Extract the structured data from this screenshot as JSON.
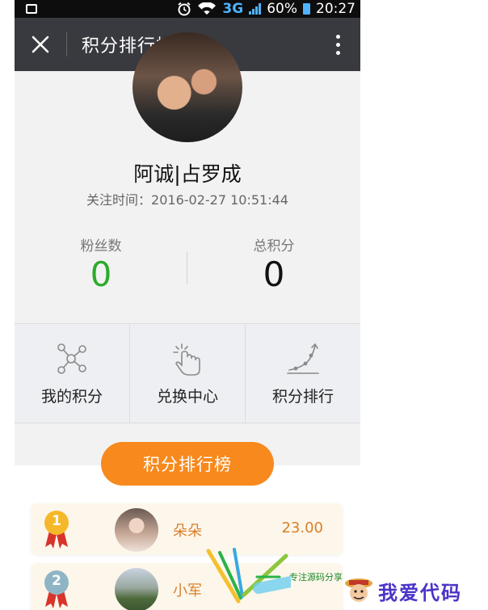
{
  "status_bar": {
    "network": "3G",
    "battery": "60%",
    "time": "20:27"
  },
  "header": {
    "title": "积分排行榜"
  },
  "profile": {
    "name": "阿诚|占罗成",
    "follow_time": "关注时间：2016-02-27 10:51:44",
    "fans_label": "粉丝数",
    "fans_value": "0",
    "points_label": "总积分",
    "points_value": "0"
  },
  "menu": {
    "items": [
      {
        "label": "我的积分",
        "icon": "network-nodes-icon"
      },
      {
        "label": "兑换中心",
        "icon": "tap-hand-icon"
      },
      {
        "label": "积分排行",
        "icon": "trend-curve-icon"
      }
    ]
  },
  "ranking": {
    "banner": "积分排行榜",
    "rows": [
      {
        "rank": "1",
        "name": "朵朵",
        "score": "23.00",
        "medal_color": "#f5b82a"
      },
      {
        "rank": "2",
        "name": "小军",
        "score": "",
        "medal_color": "#8fb5c4"
      }
    ]
  },
  "watermark": {
    "tagline": "专注源码分享",
    "brand": "我爱代码"
  },
  "colors": {
    "title_bar": "#393a3f",
    "fans_green": "#2bab2b",
    "banner_orange": "#f7891d",
    "rank_text": "#d9802a"
  }
}
